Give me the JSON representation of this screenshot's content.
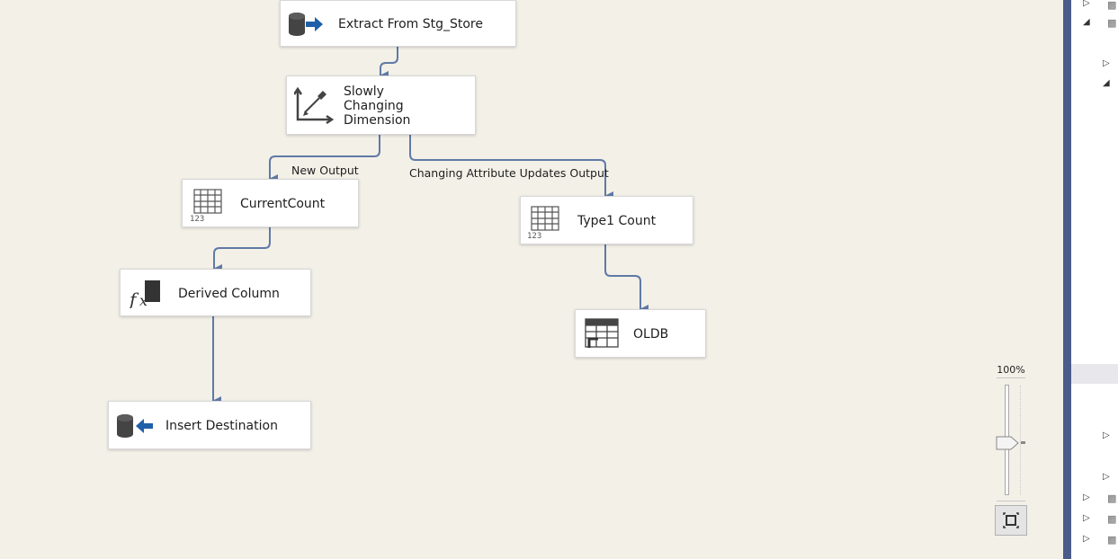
{
  "dataflow": {
    "nodes": {
      "extract": {
        "label": "Extract From Stg_Store",
        "icon": "ole-db-source-icon"
      },
      "scd": {
        "label_lines": [
          "Slowly",
          "Changing",
          "Dimension"
        ],
        "icon": "slowly-changing-dimension-icon"
      },
      "current_count": {
        "label": "CurrentCount",
        "icon": "row-count-icon"
      },
      "type1_count": {
        "label": "Type1 Count",
        "icon": "row-count-icon"
      },
      "derived_column": {
        "label": "Derived Column",
        "icon": "derived-column-icon"
      },
      "oldb": {
        "label": "OLDB",
        "icon": "ole-db-command-icon"
      },
      "insert_destination": {
        "label": "Insert Destination",
        "icon": "ole-db-destination-icon"
      }
    },
    "edges": {
      "new_output": "New Output",
      "changing_attribute_updates_output": "Changing Attribute Updates Output"
    }
  },
  "zoom": {
    "level_label": "100%",
    "fit_icon": "zoom-to-fit-icon"
  },
  "colors": {
    "canvas": "#f3f0e8",
    "connector": "#5f7aa5",
    "panel_bar": "#4b5c8a",
    "arrow_blue": "#1f5fa8"
  }
}
